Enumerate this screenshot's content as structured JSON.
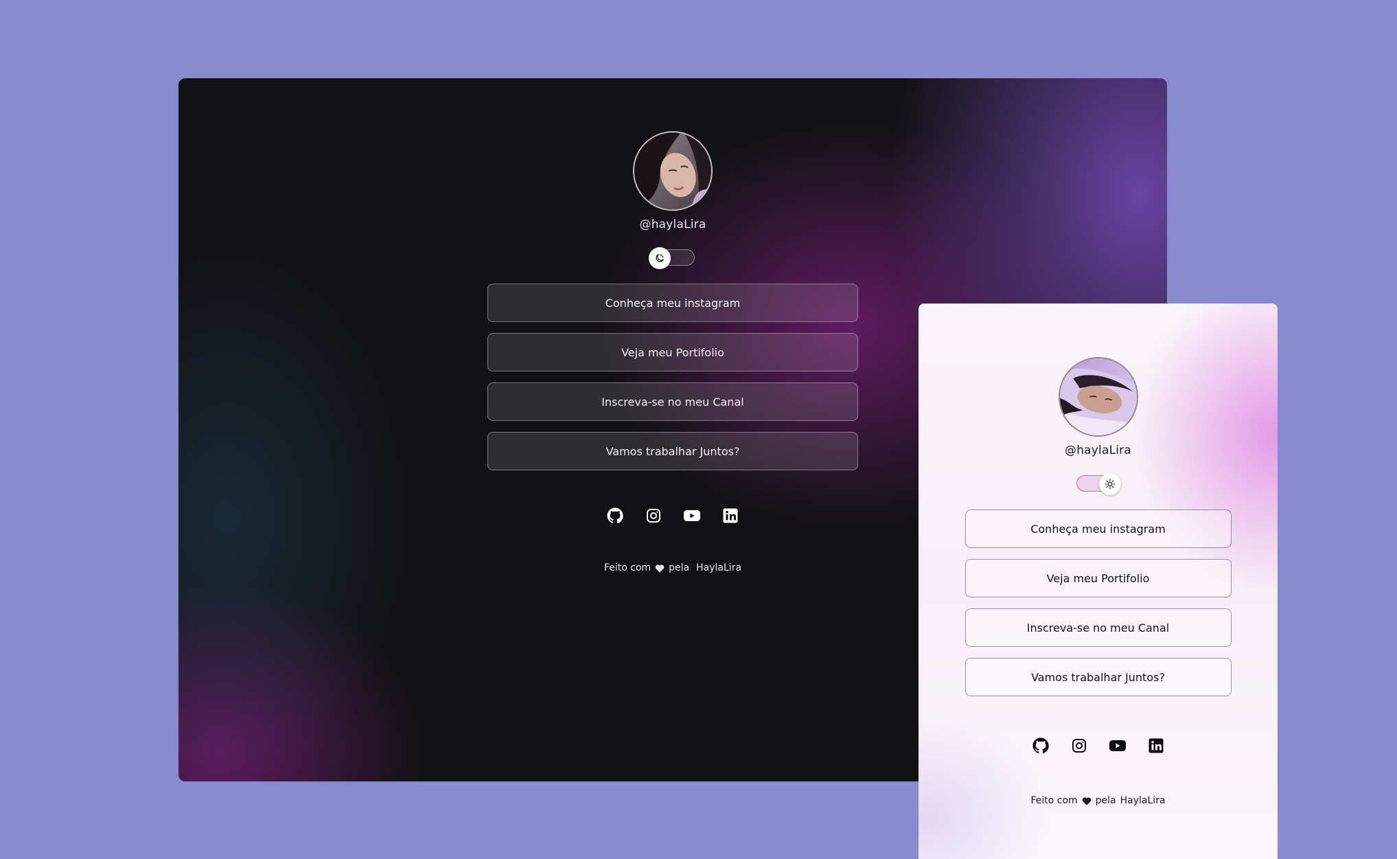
{
  "dark": {
    "handle": "@haylaLira",
    "theme_toggle_icon": "moon-icon",
    "links": [
      {
        "label": "Conheça meu instagram"
      },
      {
        "label": "Veja meu Portifolio"
      },
      {
        "label": "Inscreva-se no meu Canal"
      },
      {
        "label": "Vamos trabalhar Juntos?"
      }
    ],
    "socials": [
      "github-icon",
      "instagram-icon",
      "youtube-icon",
      "linkedin-icon"
    ],
    "footer": {
      "prefix": "Feito com",
      "middle": "pela",
      "author": "HaylaLira"
    }
  },
  "light": {
    "handle": "@haylaLira",
    "theme_toggle_icon": "sun-icon",
    "links": [
      {
        "label": "Conheça meu instagram"
      },
      {
        "label": "Veja meu Portifolio"
      },
      {
        "label": "Inscreva-se no meu Canal"
      },
      {
        "label": "Vamos trabalhar Juntos?"
      }
    ],
    "socials": [
      "github-icon",
      "instagram-icon",
      "youtube-icon",
      "linkedin-icon"
    ],
    "footer": {
      "prefix": "Feito com",
      "middle": "pela",
      "author": "HaylaLira"
    }
  },
  "colors": {
    "background": "#878bcd",
    "dark_base": "#121215",
    "dark_accent": "#7a2a80",
    "light_accent": "#e196e4"
  }
}
